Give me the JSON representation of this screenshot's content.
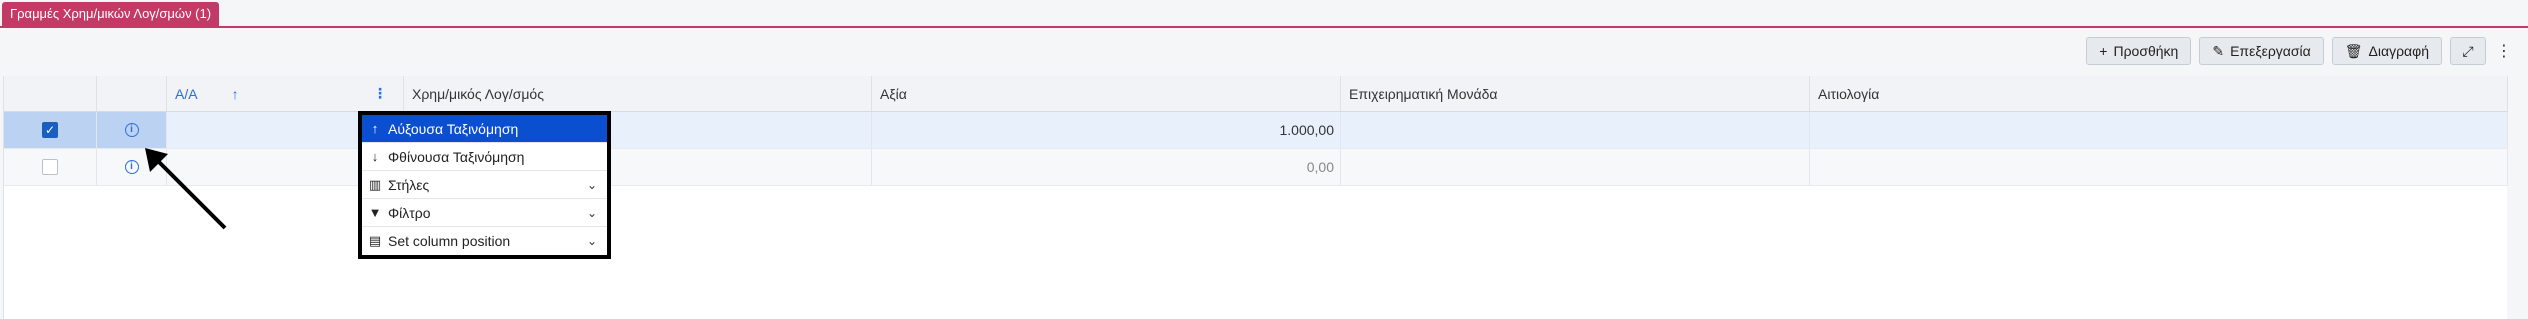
{
  "tab": {
    "label": "Γραμμές Χρημ/μικών Λογ/σμών (1)"
  },
  "toolbar": {
    "add_label": "Προσθήκη",
    "edit_label": "Επεξεργασία",
    "delete_label": "Διαγραφή"
  },
  "columns": {
    "aa": "Α/Α",
    "account": "Χρημ/μικός Λογ/σμός",
    "value": "Αξία",
    "unit": "Επιχειρηματική Μονάδα",
    "reason": "Αιτιολογία"
  },
  "rows": [
    {
      "checked": true,
      "value": "1.000,00"
    },
    {
      "checked": false,
      "value": "0,00"
    }
  ],
  "menu": {
    "items": [
      {
        "label": "Αύξουσα Ταξινόμηση",
        "icon": "sort-asc-icon"
      },
      {
        "label": "Φθίνουσα Ταξινόμηση",
        "icon": "sort-desc-icon"
      },
      {
        "label": "Στήλες",
        "icon": "columns-icon"
      },
      {
        "label": "Φίλτρο",
        "icon": "filter-icon"
      },
      {
        "label": "Set column position",
        "icon": "table-icon"
      }
    ]
  },
  "colors": {
    "tab": "#c43a67",
    "selected_menu": "#0a4fd0",
    "row_selected": "#e8f0fb"
  }
}
